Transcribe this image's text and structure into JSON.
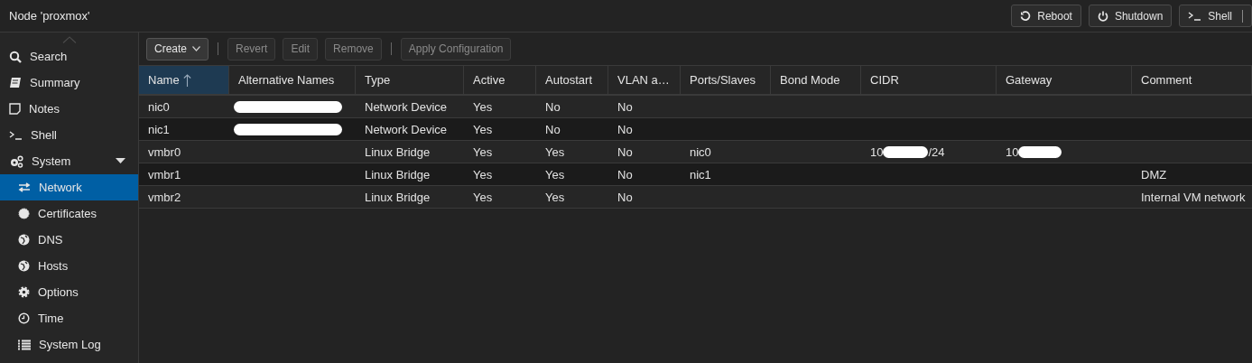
{
  "header": {
    "title": "Node 'proxmox'",
    "buttons": [
      {
        "label": "Reboot",
        "kind": "reboot"
      },
      {
        "label": "Shutdown",
        "kind": "power"
      },
      {
        "label": "Shell",
        "kind": "shell"
      }
    ]
  },
  "sidebar": {
    "items": [
      {
        "label": "Search",
        "selected": false
      },
      {
        "label": "Summary",
        "selected": false
      },
      {
        "label": "Notes",
        "selected": false
      },
      {
        "label": "Shell",
        "selected": false
      },
      {
        "label": "System",
        "selected": false,
        "expanded": true,
        "children": [
          {
            "label": "Network",
            "selected": true
          },
          {
            "label": "Certificates",
            "selected": false
          },
          {
            "label": "DNS",
            "selected": false
          },
          {
            "label": "Hosts",
            "selected": false
          },
          {
            "label": "Options",
            "selected": false
          },
          {
            "label": "Time",
            "selected": false
          },
          {
            "label": "System Log",
            "selected": false
          }
        ]
      }
    ]
  },
  "toolbar": [
    [
      {
        "label": "Create",
        "disabled": false,
        "kind": "menu"
      }
    ],
    [
      {
        "label": "Revert",
        "disabled": true,
        "kind": "plain"
      },
      {
        "label": "Edit",
        "disabled": true,
        "kind": "plain"
      },
      {
        "label": "Remove",
        "disabled": true,
        "kind": "plain"
      }
    ],
    [
      {
        "label": "Apply Configuration",
        "disabled": true,
        "kind": "plain"
      }
    ]
  ],
  "table": {
    "columns": [
      {
        "label": "Name",
        "sorted": true
      },
      {
        "label": "Alternative Names",
        "sorted": false
      },
      {
        "label": "Type",
        "sorted": false
      },
      {
        "label": "Active",
        "sorted": false
      },
      {
        "label": "Autostart",
        "sorted": false
      },
      {
        "label": "VLAN a…",
        "sorted": false
      },
      {
        "label": "Ports/Slaves",
        "sorted": false
      },
      {
        "label": "Bond Mode",
        "sorted": false
      },
      {
        "label": "CIDR",
        "sorted": false
      },
      {
        "label": "Gateway",
        "sorted": false
      },
      {
        "label": "Comment",
        "sorted": false
      }
    ],
    "rows": [
      {
        "cells": [
          {
            "text": "nic0"
          },
          {
            "redacted": true
          },
          {
            "text": "Network Device"
          },
          {
            "text": "Yes"
          },
          {
            "text": "No"
          },
          {
            "text": "No"
          },
          {},
          {},
          {},
          {},
          {}
        ]
      },
      {
        "cells": [
          {
            "text": "nic1"
          },
          {
            "redacted": true
          },
          {
            "text": "Network Device"
          },
          {
            "text": "Yes"
          },
          {
            "text": "No"
          },
          {
            "text": "No"
          },
          {},
          {},
          {},
          {},
          {}
        ]
      },
      {
        "cells": [
          {
            "text": "vmbr0"
          },
          {},
          {
            "text": "Linux Bridge"
          },
          {
            "text": "Yes"
          },
          {
            "text": "Yes"
          },
          {
            "text": "No"
          },
          {
            "text": "nic0"
          },
          {},
          {
            "text": "10",
            "suffix": "/24",
            "redacted": true
          },
          {
            "text": "10",
            "redacted": true
          },
          {}
        ]
      },
      {
        "cells": [
          {
            "text": "vmbr1"
          },
          {},
          {
            "text": "Linux Bridge"
          },
          {
            "text": "Yes"
          },
          {
            "text": "Yes"
          },
          {
            "text": "No"
          },
          {
            "text": "nic1"
          },
          {},
          {},
          {},
          {
            "text": "DMZ"
          }
        ]
      },
      {
        "cells": [
          {
            "text": "vmbr2"
          },
          {},
          {
            "text": "Linux Bridge"
          },
          {
            "text": "Yes"
          },
          {
            "text": "Yes"
          },
          {
            "text": "No"
          },
          {},
          {},
          {},
          {},
          {
            "text": "Internal VM network"
          }
        ]
      }
    ]
  }
}
